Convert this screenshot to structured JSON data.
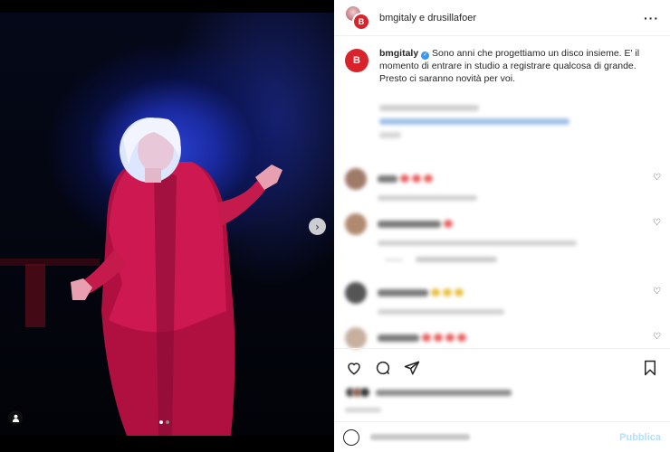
{
  "post": {
    "header_title": "bmgitaly e drusillafoer",
    "author_logo_letter": "B",
    "caption_user": "bmgitaly",
    "caption_text": "Sono anni che progettiamo un disco insieme. E' il momento di entrare in studio a registrare qualcosa di grande. Presto ci saranno novità per voi.",
    "more_icon": "more-horizontal-icon"
  },
  "media": {
    "next_icon": "chevron-right-icon",
    "tag_icon": "user-tag-icon",
    "carousel": {
      "count": 2,
      "active_index": 0
    }
  },
  "actions": {
    "publish_label": "Pubblica"
  },
  "colors": {
    "brand_red": "#d8232a",
    "verified_blue": "#3897f0",
    "publish_disabled": "#b2dffc"
  }
}
